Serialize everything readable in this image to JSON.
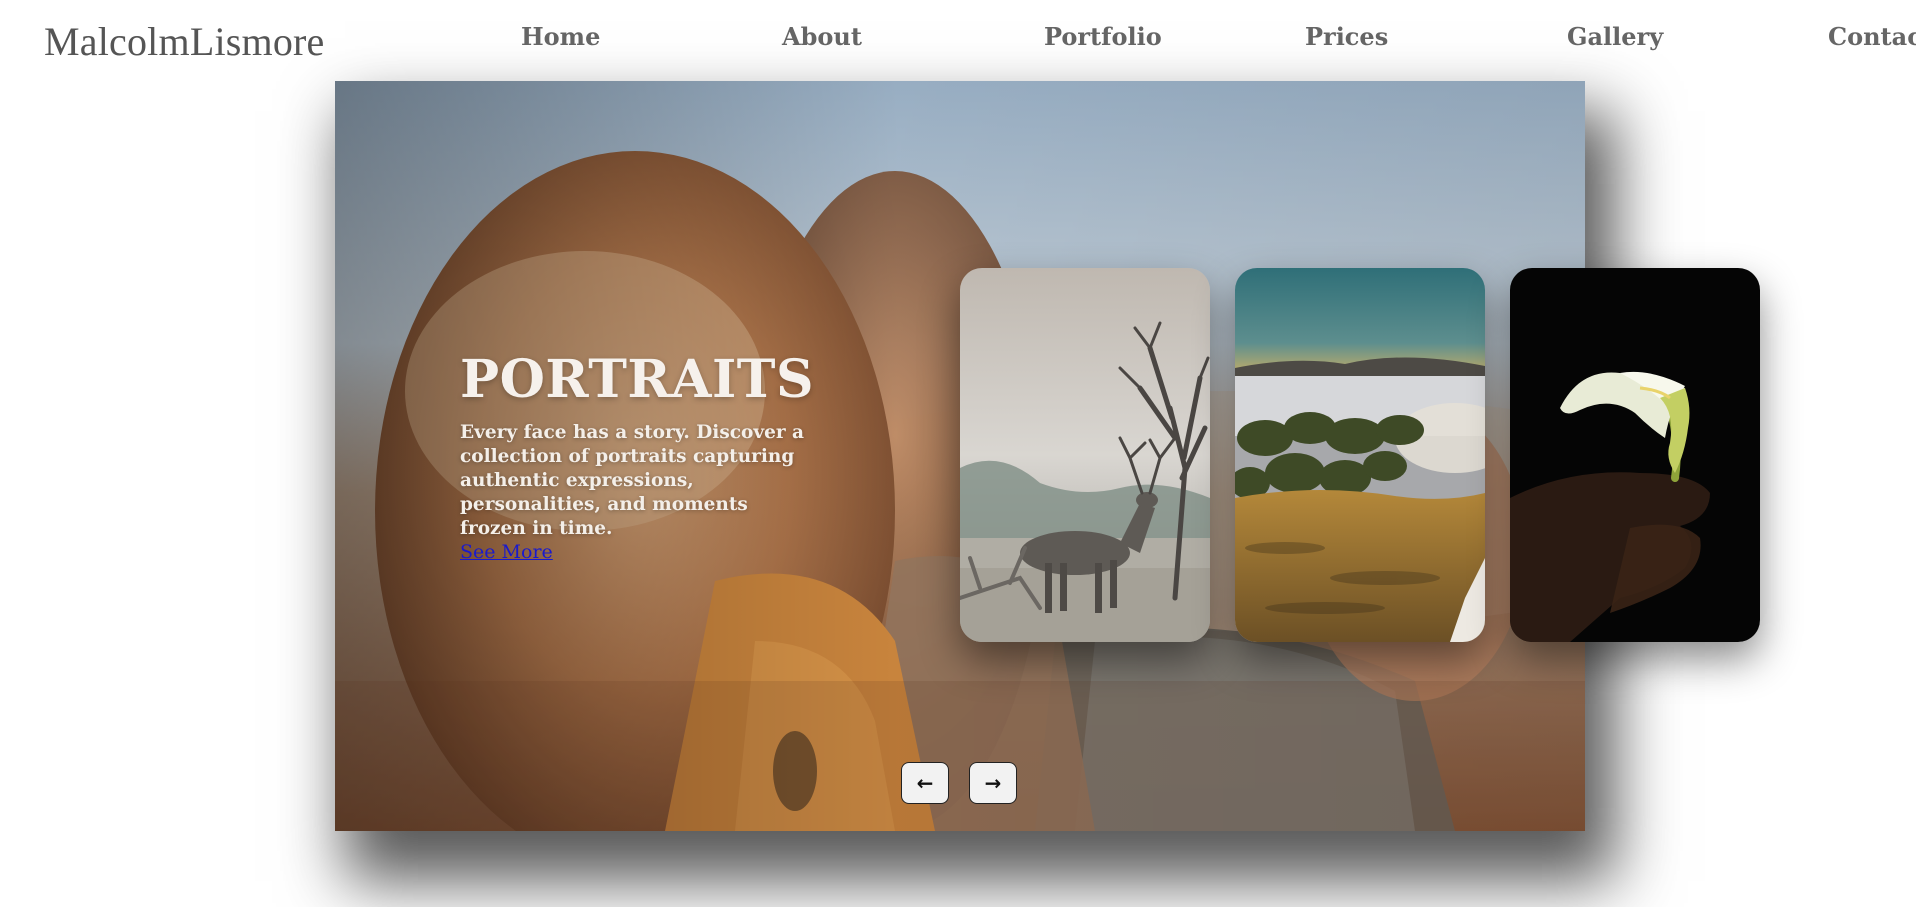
{
  "header": {
    "logo": "MalcolmLismore",
    "nav": [
      "Home",
      "About",
      "Portfolio",
      "Prices",
      "Gallery",
      "Contact"
    ]
  },
  "hero": {
    "title": "PORTRAITS",
    "description": "Every face has a story. Discover a collection of portraits capturing authentic expressions, personalities, and moments frozen in time.",
    "link": "See More"
  },
  "slider": {
    "prev_icon": "arrow-left-icon",
    "next_icon": "arrow-right-icon",
    "prev_glyph": "←",
    "next_glyph": "→"
  },
  "cards": [
    {
      "subject": "deer-icon"
    },
    {
      "subject": "landscape-icon"
    },
    {
      "subject": "calla-lily-icon"
    }
  ]
}
